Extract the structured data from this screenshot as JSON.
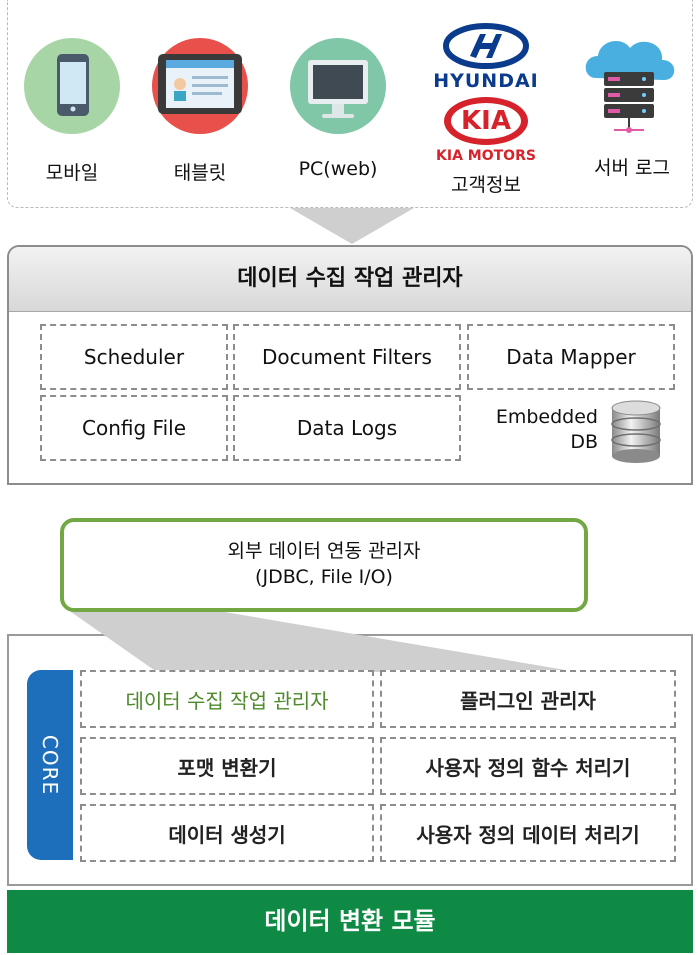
{
  "sources": [
    {
      "label": "모바일",
      "icon": "mobile-phone-icon",
      "color": "#a8d5a5"
    },
    {
      "label": "태블릿",
      "icon": "tablet-icon",
      "color": "#e8504c"
    },
    {
      "label": "PC(web)",
      "icon": "monitor-icon",
      "color": "#7fc7a7"
    },
    {
      "label": "고객정보",
      "icon": "hyundai-kia-logo",
      "color": "#0b3b8c"
    },
    {
      "label": "서버 로그",
      "icon": "cloud-server-icon",
      "color": "#49aee0"
    }
  ],
  "logos": {
    "hyundai": "HYUNDAI",
    "kia": "KIA",
    "kia_motors": "KIA MOTORS"
  },
  "job_manager": {
    "title": "데이터 수집 작업 관리자",
    "items": {
      "scheduler": "Scheduler",
      "document_filters": "Document Filters",
      "data_mapper": "Data Mapper",
      "config_file": "Config File",
      "data_logs": "Data Logs",
      "embedded_db": "Embedded DB"
    }
  },
  "external_manager": {
    "title": "외부 데이터 연동 관리자",
    "subtitle": "(JDBC, File I/O)"
  },
  "core": {
    "tab_label": "CORE",
    "items": {
      "collect_job": "데이터 수집 작업 관리자",
      "plugin": "플러그인 관리자",
      "format_converter": "포맷 변환기",
      "user_function": "사용자 정의 함수 처리기",
      "data_generator": "데이터 생성기",
      "user_data": "사용자 정의 데이터 처리기"
    }
  },
  "module_bar": "데이터 변환 모듈",
  "colors": {
    "green_border": "#73a743",
    "core_blue": "#1d6fbb",
    "bottom_green": "#0f8a45",
    "highlight_text": "#4c8a2a"
  }
}
